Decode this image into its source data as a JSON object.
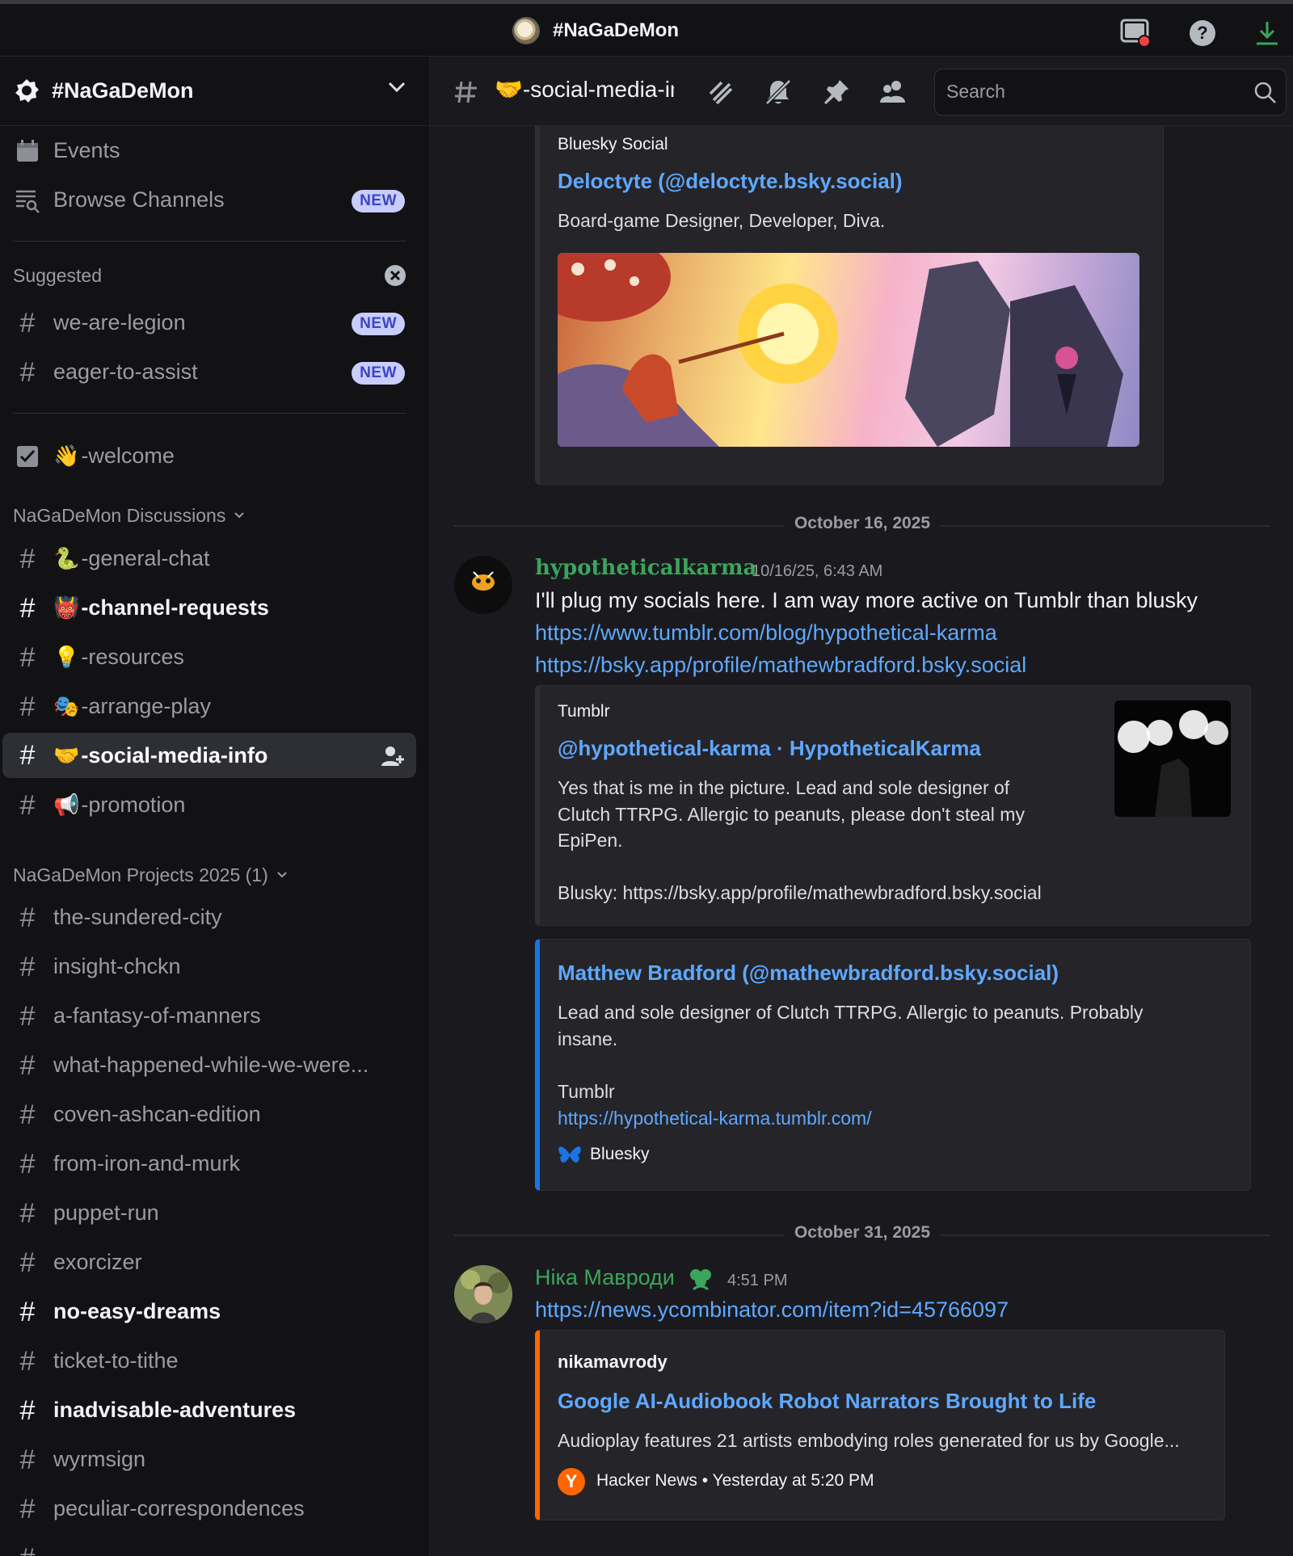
{
  "titlebar": {
    "title": "#NaGaDeMon"
  },
  "sidebar": {
    "server_name": "#NaGaDeMon",
    "events_label": "Events",
    "browse_label": "Browse Channels",
    "new_badge": "NEW",
    "suggested_label": "Suggested",
    "suggested": [
      {
        "name": "we-are-legion"
      },
      {
        "name": "eager-to-assist"
      }
    ],
    "welcome": {
      "emoji": "👋",
      "name": "-welcome"
    },
    "discussions_label": "NaGaDeMon Discussions",
    "discussions": [
      {
        "emoji": "🐍",
        "name": "-general-chat"
      },
      {
        "emoji": "👹",
        "name": "-channel-requests"
      },
      {
        "emoji": "💡",
        "name": "-resources"
      },
      {
        "emoji": "🎭",
        "name": "-arrange-play"
      },
      {
        "emoji": "🤝",
        "name": "-social-media-info"
      },
      {
        "emoji": "📢",
        "name": "-promotion"
      }
    ],
    "projects_label": "NaGaDeMon Projects 2025 (1)",
    "projects": [
      {
        "name": "the-sundered-city"
      },
      {
        "name": "insight-chckn"
      },
      {
        "name": "a-fantasy-of-manners"
      },
      {
        "name": "what-happened-while-we-were..."
      },
      {
        "name": "coven-ashcan-edition"
      },
      {
        "name": "from-iron-and-murk"
      },
      {
        "name": "puppet-run"
      },
      {
        "name": "exorcizer"
      },
      {
        "name": "no-easy-dreams"
      },
      {
        "name": "ticket-to-tithe"
      },
      {
        "name": "inadvisable-adventures"
      },
      {
        "name": "wyrmsign"
      },
      {
        "name": "peculiar-correspondences"
      }
    ]
  },
  "channel_header": {
    "emoji": "🤝",
    "name": "-social-media-in",
    "search_placeholder": "Search"
  },
  "messages": {
    "embed0": {
      "provider": "Bluesky Social",
      "title": "Deloctyte (@deloctyte.bsky.social)",
      "desc": "Board-game Designer, Developer, Diva."
    },
    "date1": "October 16, 2025",
    "msg1": {
      "author": "hypotheticalkarma",
      "author_color": "#3ba55c",
      "time": "10/16/25, 6:43 AM",
      "text": "I'll plug my socials here. I am way more active on Tumblr than blusky",
      "link1": "https://www.tumblr.com/blog/hypothetical-karma",
      "link2": "https://bsky.app/profile/mathewbradford.bsky.social"
    },
    "embed1": {
      "provider": "Tumblr",
      "title": "@hypothetical-karma · HypotheticalKarma",
      "desc1": "Yes that is me in the picture. Lead and sole designer of",
      "desc2": "Clutch TTRPG. Allergic to peanuts, please don't steal my",
      "desc3": "EpiPen.",
      "desc4": "Blusky: https://bsky.app/profile/mathewbradford.bsky.social"
    },
    "embed2": {
      "title": "Matthew Bradford (@mathewbradford.bsky.social)",
      "desc1": "Lead and sole designer of Clutch TTRPG. Allergic to peanuts. Probably",
      "desc2": "insane.",
      "desc3": "Tumblr",
      "link": "https://hypothetical-karma.tumblr.com/",
      "footer": "Bluesky"
    },
    "date2": "October 31, 2025",
    "msg2": {
      "author": "Ніка Мавроди",
      "author_color": "#3ba55c",
      "time": "4:51 PM",
      "link": "https://news.ycombinator.com/item?id=45766097"
    },
    "embed3": {
      "provider": "nikamavrody",
      "title": "Google AI-Audiobook Robot Narrators Brought to Life",
      "desc": "Audioplay features 21 artists embodying roles generated for us by Google...",
      "footer_source": "Hacker News",
      "footer_sep": "•",
      "footer_time": "Yesterday at 5:20 PM"
    }
  },
  "colors": {
    "link": "#5fa8ff",
    "badge_bg": "#c9cdfb",
    "bluesky_bar": "#1b74e4",
    "hn_bar": "#ff6600"
  }
}
